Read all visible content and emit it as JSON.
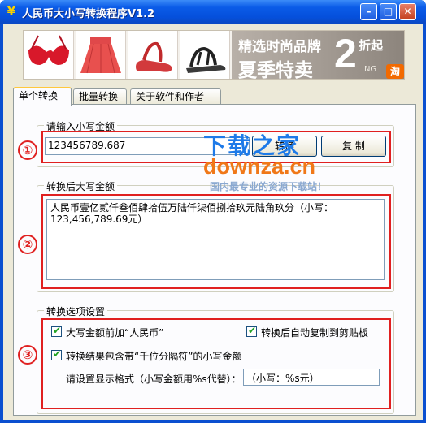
{
  "window": {
    "title": "人民币大小写转换程序V1.2",
    "icon": "yuan-icon",
    "controls": [
      "minimize",
      "maximize",
      "close"
    ]
  },
  "banner": {
    "promo_line1": "精选时尚品牌",
    "promo_line2": "夏季特卖",
    "promo_number": "2",
    "promo_suffix": "折起",
    "badge": "淘",
    "brand_fragment": "ING"
  },
  "tabs": [
    {
      "label": "单个转换",
      "active": true
    },
    {
      "label": "批量转换",
      "active": false
    },
    {
      "label": "关于软件和作者",
      "active": false
    }
  ],
  "input_group": {
    "legend": "请输入小写金额",
    "value": "123456789.687",
    "convert_label": "转换",
    "copy_label": "复 制",
    "marker": "①"
  },
  "output_group": {
    "legend": "转换后大写金额",
    "value": "人民币壹亿贰仟叁佰肆拾伍万陆仟柒佰捌拾玖元陆角玖分（小写：123,456,789.69元）",
    "marker": "②"
  },
  "options_group": {
    "legend": "转换选项设置",
    "opt_prefix": "大写金额前加“人民币”",
    "opt_autocopy": "转换后自动复制到剪贴板",
    "opt_separator": "转换结果包含带“千位分隔符”的小写金额",
    "format_label": "请设置显示格式（小写金额用%s代替）：",
    "format_value": "（小写：%s元）",
    "marker": "③"
  },
  "watermark": {
    "line1": "下载之家",
    "line2": "downza.cn",
    "line3": "国内最专业的资源下载站！"
  },
  "colors": {
    "title_bar": "#0550dc",
    "annotation_red": "#e02020",
    "watermark_blue": "#1e7ae8",
    "watermark_orange": "#f07818",
    "tab_highlight": "#ffc83c"
  }
}
